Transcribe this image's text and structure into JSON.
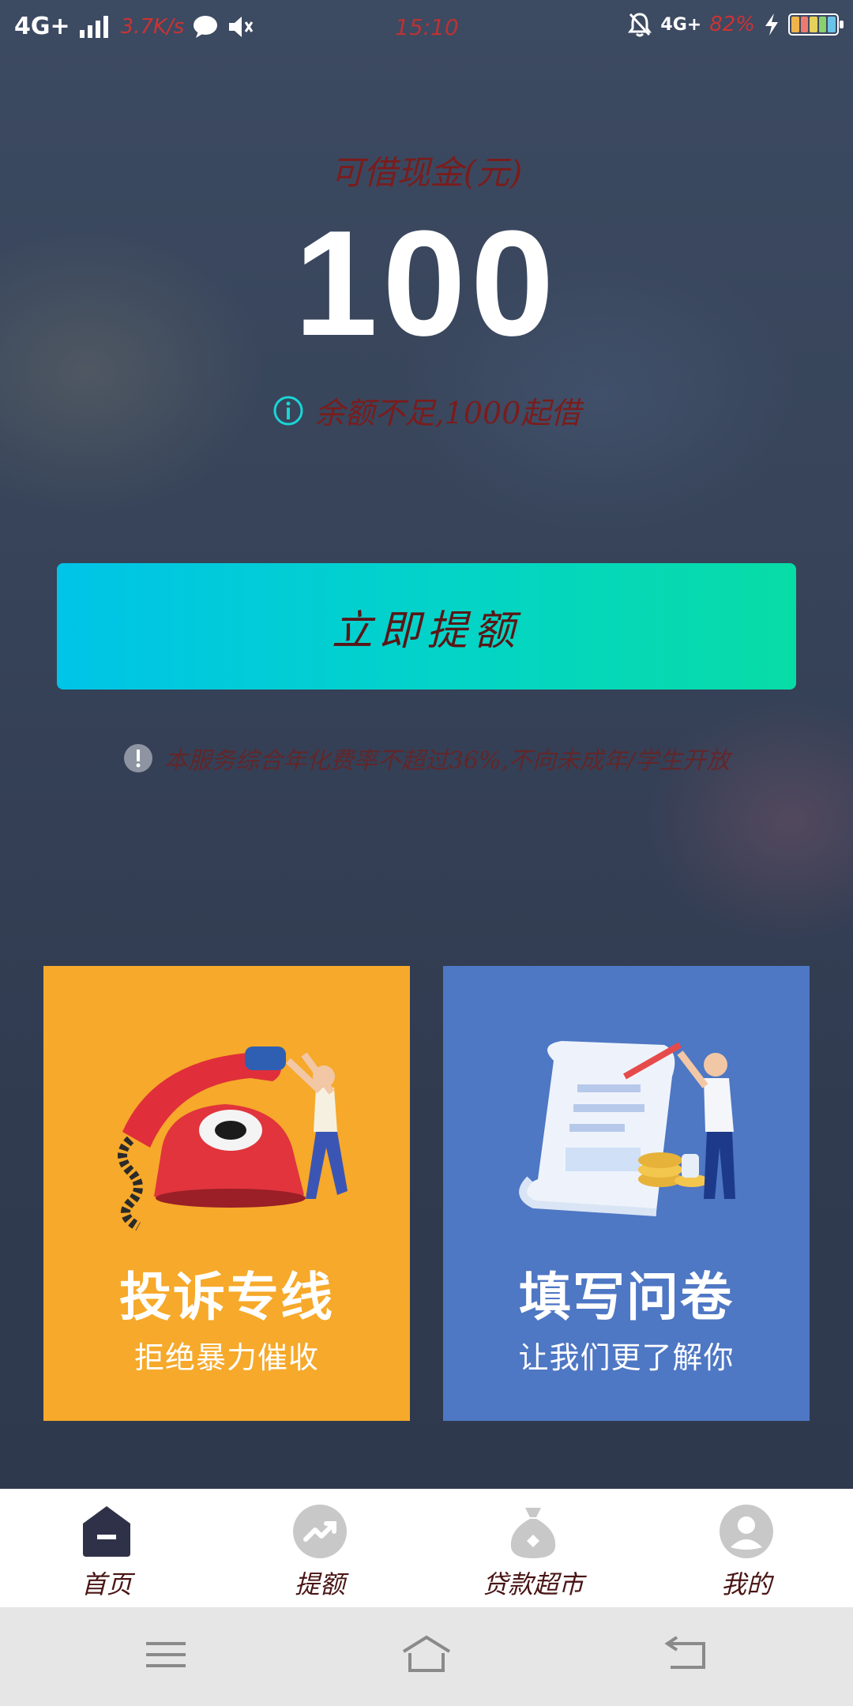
{
  "status_bar": {
    "network": "4G+",
    "speed": "3.7K/s",
    "time": "15:10",
    "network_right": "4G+",
    "battery": "82%",
    "icons": [
      "signal-icon",
      "message-icon",
      "mute-icon",
      "bell-off-icon",
      "charging-icon",
      "battery-icon"
    ]
  },
  "hero": {
    "label": "可借现金(元)",
    "amount": "100",
    "hint": "余额不足,1000起借",
    "hint_icon": "info-icon"
  },
  "cta": {
    "label": "立即提额"
  },
  "notice": {
    "text": "本服务综合年化费率不超过36%,不向未成年/学生开放",
    "icon": "exclamation-icon"
  },
  "cards": [
    {
      "title": "投诉专线",
      "subtitle": "拒绝暴力催收",
      "color": "#f6a92a",
      "icon": "telephone-illustration"
    },
    {
      "title": "填写问卷",
      "subtitle": "让我们更了解你",
      "color": "#4e77c4",
      "icon": "survey-illustration"
    }
  ],
  "tabs": [
    {
      "label": "首页",
      "icon": "home-icon",
      "active": true
    },
    {
      "label": "提额",
      "icon": "trend-up-icon",
      "active": false
    },
    {
      "label": "贷款超市",
      "icon": "money-bag-icon",
      "active": false
    },
    {
      "label": "我的",
      "icon": "user-icon",
      "active": false
    }
  ],
  "colors": {
    "accent_start": "#00c4e8",
    "accent_end": "#08dca6",
    "tab_active": "#2f3148",
    "tab_inactive": "#c8c8c8"
  }
}
